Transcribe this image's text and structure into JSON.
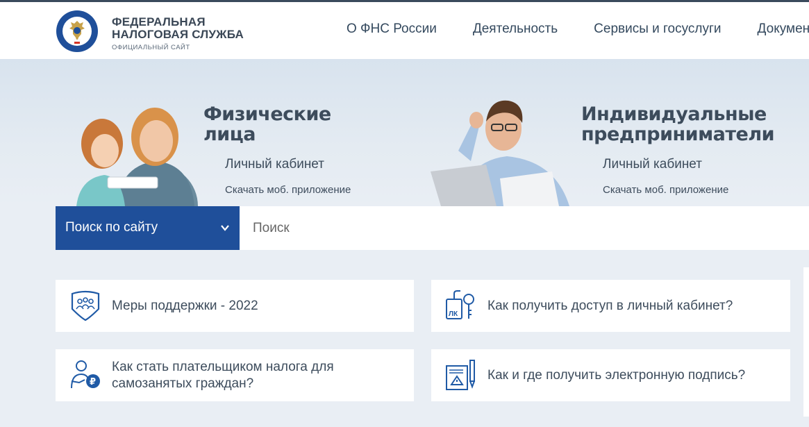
{
  "header": {
    "logo_title_line1": "ФЕДЕРАЛЬНАЯ",
    "logo_title_line2": "НАЛОГОВАЯ СЛУЖБА",
    "logo_subtitle": "ОФИЦИАЛЬНЫЙ САЙТ",
    "emblem_text": "ФЕДЕРАЛЬНАЯ НАЛОГОВАЯ СЛУЖБА",
    "nav": [
      "О ФНС России",
      "Деятельность",
      "Сервисы и госуслуги",
      "Документы"
    ]
  },
  "hero": {
    "individuals": {
      "title_line1": "Физические",
      "title_line2": "лица",
      "cabinet": "Личный кабинет",
      "app": "Скачать моб. приложение"
    },
    "entrepreneurs": {
      "title_line1": "Индивидуальные",
      "title_line2": "предприниматели",
      "cabinet": "Личный кабинет",
      "app": "Скачать моб. приложение"
    }
  },
  "search": {
    "scope": "Поиск по сайту",
    "placeholder": "Поиск"
  },
  "cards": [
    {
      "line1": "Меры поддержки - 2022",
      "line2": "",
      "icon": "shield-people-icon"
    },
    {
      "line1": "Как получить доступ в личный кабинет?",
      "line2": "",
      "icon": "lk-key-icon"
    },
    {
      "line1": "Как стать плательщиком налога для",
      "line2": "самозанятых граждан?",
      "icon": "person-ruble-icon"
    },
    {
      "line1": "Как и где получить электронную подпись?",
      "line2": "",
      "icon": "signature-document-icon"
    }
  ],
  "colors": {
    "brand_blue": "#1f4f9a",
    "icon_blue": "#1f5aa6",
    "text": "#3d4c5c",
    "background": "#e9eef4"
  }
}
